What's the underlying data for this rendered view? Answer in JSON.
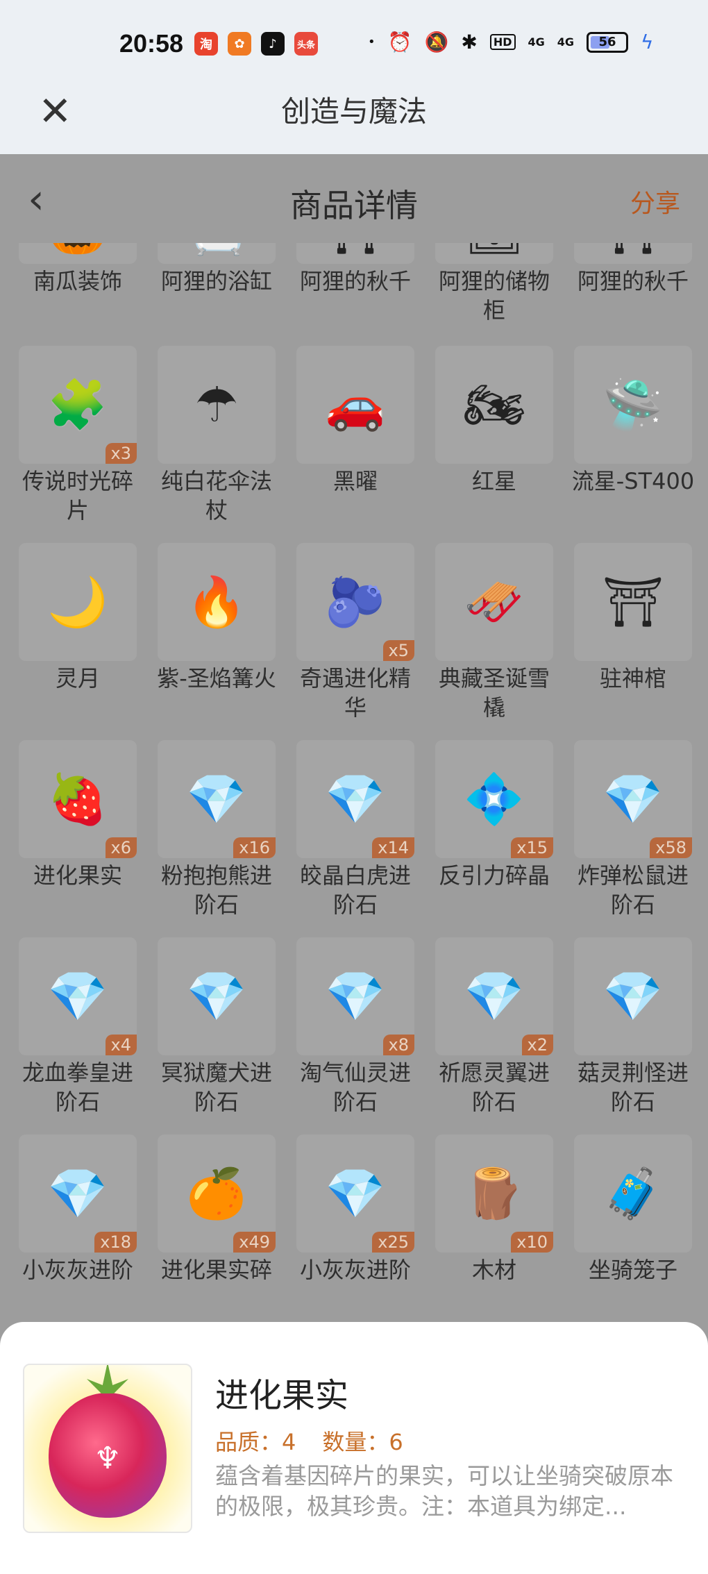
{
  "status_bar": {
    "time": "20:58",
    "apps": [
      {
        "name": "taobao",
        "glyph": "淘",
        "color": "#e8432d"
      },
      {
        "name": "app-orange",
        "glyph": "✿",
        "color": "#f07a23"
      },
      {
        "name": "tiktok",
        "glyph": "♪",
        "color": "#111111"
      },
      {
        "name": "toutiao",
        "glyph": "头条",
        "color": "#e84a3c"
      }
    ],
    "dot": "•",
    "hd_label": "HD",
    "net1": "4G",
    "net2": "4G",
    "battery": "56"
  },
  "app_title_bar": {
    "close_icon": "close-icon",
    "title": "创造与魔法"
  },
  "page_header": {
    "back_icon": "chevron-left-icon",
    "title": "商品详情",
    "share_label": "分享"
  },
  "items": [
    [
      {
        "name": "南瓜装饰",
        "badge": "",
        "glyph": "🎃"
      },
      {
        "name": "阿狸的浴缸",
        "badge": "",
        "glyph": "🛁"
      },
      {
        "name": "阿狸的秋千",
        "badge": "",
        "glyph": "⛩"
      },
      {
        "name": "阿狸的储物柜",
        "badge": "",
        "glyph": "🗄"
      },
      {
        "name": "阿狸的秋千",
        "badge": "",
        "glyph": "⛩"
      }
    ],
    [
      {
        "name": "传说时光碎片",
        "badge": "x3",
        "glyph": "🧩"
      },
      {
        "name": "纯白花伞法杖",
        "badge": "",
        "glyph": "☂"
      },
      {
        "name": "黑曜",
        "badge": "",
        "glyph": "🚗"
      },
      {
        "name": "红星",
        "badge": "",
        "glyph": "🏍"
      },
      {
        "name": "流星-ST400",
        "badge": "",
        "glyph": "🛸"
      }
    ],
    [
      {
        "name": "灵月",
        "badge": "",
        "glyph": "🌙"
      },
      {
        "name": "紫-圣焰篝火",
        "badge": "",
        "glyph": "🔥"
      },
      {
        "name": "奇遇进化精华",
        "badge": "x5",
        "glyph": "🫐"
      },
      {
        "name": "典藏圣诞雪橇",
        "badge": "",
        "glyph": "🛷"
      },
      {
        "name": "驻神棺",
        "badge": "",
        "glyph": "⛩"
      }
    ],
    [
      {
        "name": "进化果实",
        "badge": "x6",
        "glyph": "🍓"
      },
      {
        "name": "粉抱抱熊进阶石",
        "badge": "x16",
        "glyph": "💎"
      },
      {
        "name": "皎晶白虎进阶石",
        "badge": "x14",
        "glyph": "💎"
      },
      {
        "name": "反引力碎晶",
        "badge": "x15",
        "glyph": "💠"
      },
      {
        "name": "炸弹松鼠进阶石",
        "badge": "x58",
        "glyph": "💎"
      }
    ],
    [
      {
        "name": "龙血拳皇进阶石",
        "badge": "x4",
        "glyph": "💎"
      },
      {
        "name": "冥狱魔犬进阶石",
        "badge": "",
        "glyph": "💎"
      },
      {
        "name": "淘气仙灵进阶石",
        "badge": "x8",
        "glyph": "💎"
      },
      {
        "name": "祈愿灵翼进阶石",
        "badge": "x2",
        "glyph": "💎"
      },
      {
        "name": "菇灵荆怪进阶石",
        "badge": "",
        "glyph": "💎"
      }
    ],
    [
      {
        "name": "小灰灰进阶",
        "badge": "x18",
        "glyph": "💎"
      },
      {
        "name": "进化果实碎",
        "badge": "x49",
        "glyph": "🍊"
      },
      {
        "name": "小灰灰进阶",
        "badge": "x25",
        "glyph": "💎"
      },
      {
        "name": "木材",
        "badge": "x10",
        "glyph": "🪵"
      },
      {
        "name": "坐骑笼子",
        "badge": "",
        "glyph": "🧳"
      }
    ]
  ],
  "sheet": {
    "title": "进化果实",
    "quality": "品质：4",
    "count": "数量：6",
    "description": "蕴含着基因碎片的果实，可以让坐骑突破原本的极限，极其珍贵。注：本道具为绑定..."
  }
}
